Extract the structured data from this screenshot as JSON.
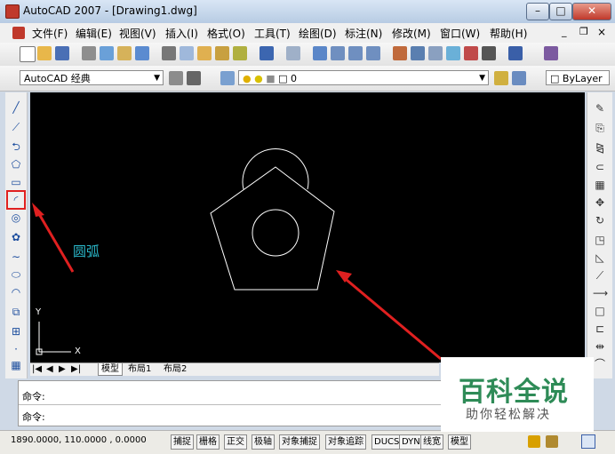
{
  "window": {
    "title": "AutoCAD 2007 - [Drawing1.dwg]",
    "min": "–",
    "max": "□",
    "close": "✕"
  },
  "menu": [
    "文件(F)",
    "编辑(E)",
    "视图(V)",
    "插入(I)",
    "格式(O)",
    "工具(T)",
    "绘图(D)",
    "标注(N)",
    "修改(M)",
    "窗口(W)",
    "帮助(H)"
  ],
  "doc_controls": {
    "min": "_",
    "restore": "❐",
    "close": "×"
  },
  "toolbar2": {
    "workspace": "AutoCAD 经典",
    "layer": "0",
    "linetype": "ByLayer"
  },
  "annotation": {
    "label": "圆弧"
  },
  "ucs": {
    "x": "X",
    "y": "Y"
  },
  "tabs": [
    "模型",
    "布局1",
    "布局2"
  ],
  "command": {
    "line1": "命令:",
    "line2": "命令:"
  },
  "status": {
    "coords": "1890.0000, 110.0000 , 0.0000",
    "buttons": [
      "捕捉",
      "栅格",
      "正交",
      "极轴",
      "对象捕捉",
      "对象追踪",
      "DUCS",
      "DYN",
      "线宽",
      "模型"
    ]
  },
  "watermark": {
    "main": "百科全说",
    "sub": "助你轻松解决"
  },
  "colors": {
    "canvas": "#000000",
    "highlight": "#e02020",
    "annotation": "#2ab7c9"
  }
}
